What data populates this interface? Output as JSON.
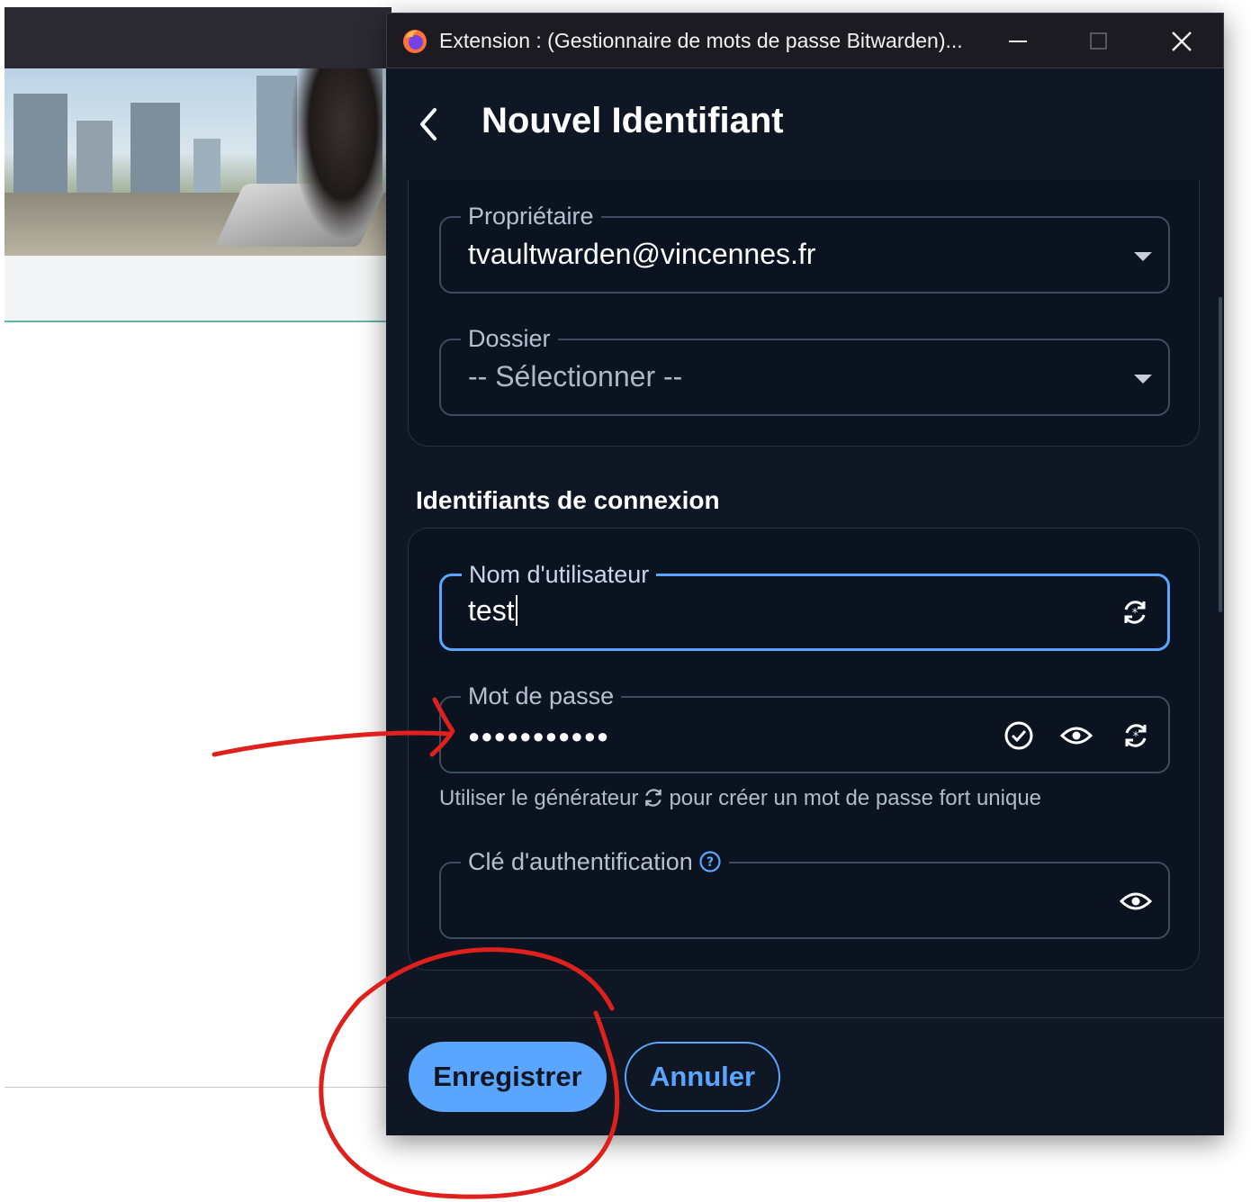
{
  "window": {
    "title": "Extension : (Gestionnaire de mots de passe Bitwarden)...",
    "app_icon": "firefox-icon",
    "controls": [
      "minimize-icon",
      "maximize-icon",
      "close-icon"
    ]
  },
  "header": {
    "back_icon": "chevron-left-icon",
    "title": "Nouvel Identifiant"
  },
  "item_details": {
    "owner": {
      "label": "Propriétaire",
      "value": "tvaultwarden@vincennes.fr"
    },
    "folder": {
      "label": "Dossier",
      "value": "-- Sélectionner --"
    }
  },
  "login_credentials": {
    "section_title": "Identifiants de connexion",
    "username": {
      "label": "Nom d'utilisateur",
      "value": "test",
      "icon": "generate-icon"
    },
    "password": {
      "label": "Mot de passe",
      "value": "●●●●●●●●●●●",
      "icons": [
        "check-circle-icon",
        "eye-icon",
        "generate-icon"
      ],
      "hint_before": "Utiliser le générateur",
      "hint_after": "pour créer un mot de passe fort unique"
    },
    "totp": {
      "label": "Clé d'authentification",
      "help_icon": "question-circle-icon",
      "value": "",
      "icon": "eye-icon"
    }
  },
  "footer": {
    "save_label": "Enregistrer",
    "cancel_label": "Annuler"
  },
  "colors": {
    "background": "#0f1624",
    "card": "#0c1320",
    "primary": "#5aa6ff",
    "annotation": "#e0201c"
  }
}
